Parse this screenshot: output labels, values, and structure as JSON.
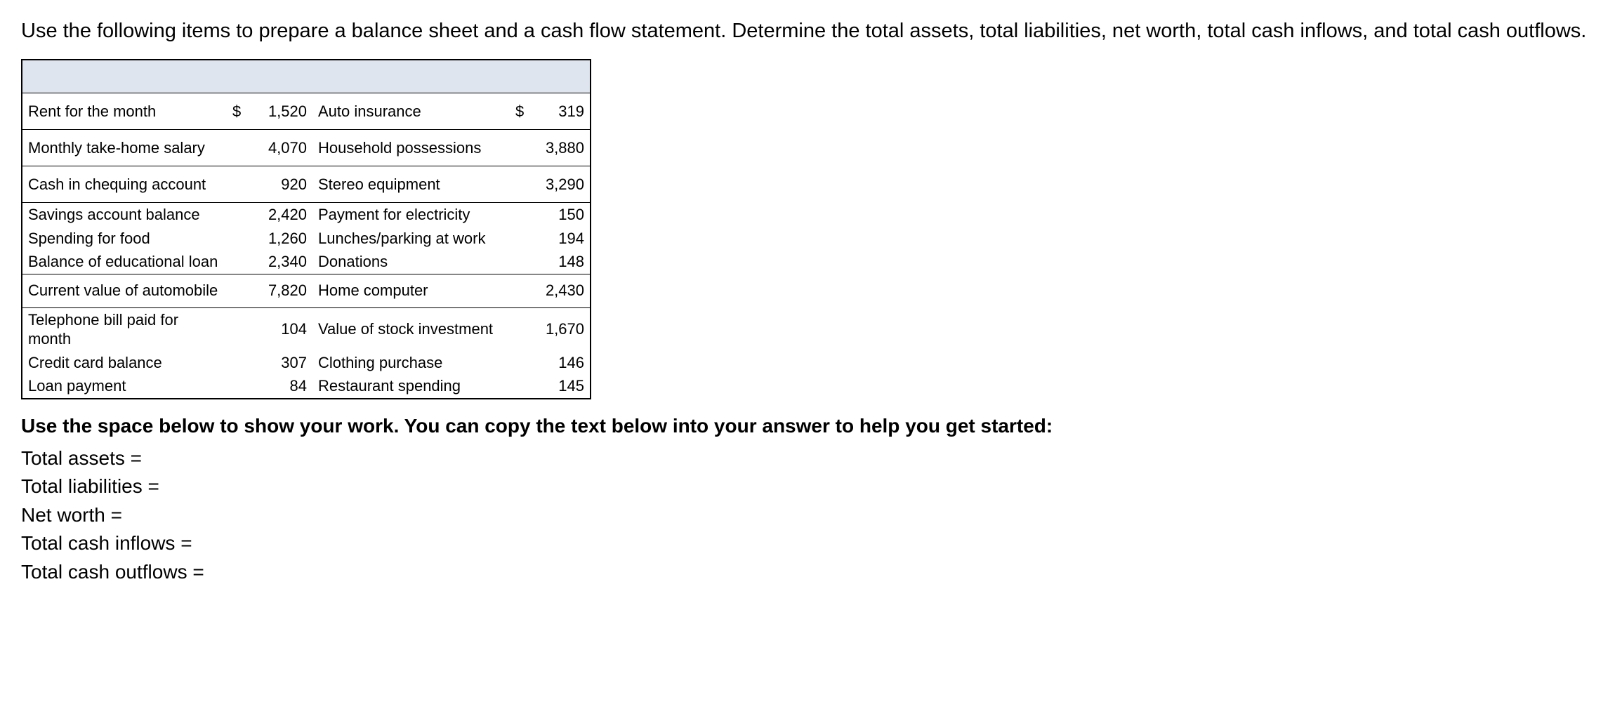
{
  "question": "Use the following items to prepare a balance sheet and a cash flow statement. Determine the total assets, total liabilities, net worth, total cash inflows, and total cash outflows.",
  "rows": {
    "r1": {
      "l_label": "Rent for the month",
      "l_sym": "$",
      "l_val": "1,520",
      "r_label": "Auto insurance",
      "r_sym": "$",
      "r_val": "319"
    },
    "r2": {
      "l_label": "Monthly take-home salary",
      "l_sym": "",
      "l_val": "4,070",
      "r_label": "Household possessions",
      "r_sym": "",
      "r_val": "3,880"
    },
    "r3": {
      "l_label": "Cash in chequing account",
      "l_sym": "",
      "l_val": "920",
      "r_label": "Stereo equipment",
      "r_sym": "",
      "r_val": "3,290"
    },
    "r4": {
      "l_label": "Savings account balance",
      "l_sym": "",
      "l_val": "2,420",
      "r_label": "Payment for electricity",
      "r_sym": "",
      "r_val": "150"
    },
    "r5": {
      "l_label": "Spending for food",
      "l_sym": "",
      "l_val": "1,260",
      "r_label": "Lunches/parking at work",
      "r_sym": "",
      "r_val": "194"
    },
    "r6": {
      "l_label": "Balance of educational loan",
      "l_sym": "",
      "l_val": "2,340",
      "r_label": "Donations",
      "r_sym": "",
      "r_val": "148"
    },
    "r7": {
      "l_label": "Current value of automobile",
      "l_sym": "",
      "l_val": "7,820",
      "r_label": "Home computer",
      "r_sym": "",
      "r_val": "2,430"
    },
    "r8": {
      "l_label": "Telephone bill paid for month",
      "l_sym": "",
      "l_val": "104",
      "r_label": "Value of stock investment",
      "r_sym": "",
      "r_val": "1,670"
    },
    "r9": {
      "l_label": "Credit card balance",
      "l_sym": "",
      "l_val": "307",
      "r_label": "Clothing purchase",
      "r_sym": "",
      "r_val": "146"
    },
    "r10": {
      "l_label": "Loan payment",
      "l_sym": "",
      "l_val": "84",
      "r_label": "Restaurant spending",
      "r_sym": "",
      "r_val": "145"
    }
  },
  "instructions": "Use the space below to show your work. You can copy the text below into your answer to help you get started:",
  "work": {
    "total_assets": "Total assets =",
    "total_liabilities": "Total liabilities =",
    "net_worth": "Net worth =",
    "total_cash_inflows": "Total cash inflows =",
    "total_cash_outflows": "Total cash outflows ="
  }
}
